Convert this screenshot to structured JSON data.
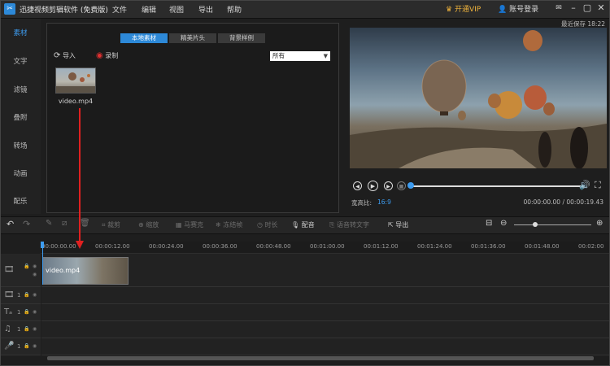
{
  "titlebar": {
    "app_title": "迅捷视频剪辑软件 (免费版)",
    "menus": [
      "文件",
      "编辑",
      "视图",
      "导出",
      "帮助"
    ],
    "vip": "开通VIP",
    "login": "账号登录",
    "icons": [
      "app-logo-icon",
      "vip-crown-icon",
      "user-icon",
      "feedback-icon",
      "minimize-icon",
      "maximize-icon",
      "close-icon"
    ]
  },
  "leftnav": {
    "items": [
      "素材",
      "文字",
      "滤镜",
      "叠附",
      "转场",
      "动画",
      "配乐"
    ],
    "active": "素材"
  },
  "media": {
    "tabs": [
      "本地素材",
      "精美片头",
      "背景样例"
    ],
    "active_tab": "本地素材",
    "import_label": "导入",
    "record_label": "录制",
    "filter_value": "所有",
    "files": [
      {
        "name": "video.mp4"
      }
    ]
  },
  "preview": {
    "autosave": "最近保存 18:22",
    "aspect_label": "宽高比:",
    "aspect_value": "16:9",
    "timecode": "00:00:00.00 / 00:00:19.43",
    "progress": 0
  },
  "toolbar": {
    "items": [
      "裁剪",
      "缩放",
      "马赛克",
      "冻结帧",
      "时长",
      "配音",
      "语音转文字",
      "导出"
    ],
    "enabled": [
      "配音",
      "导出"
    ]
  },
  "timeline": {
    "ticks": [
      "00:00:00.00",
      "00:00:12.00",
      "00:00:24.00",
      "00:00:36.00",
      "00:00:48.00",
      "00:01:00.00",
      "00:01:12.00",
      "00:01:24.00",
      "00:01:36.00",
      "00:01:48.00",
      "00:02:00"
    ],
    "tracks": [
      {
        "type": "video",
        "icon": "film-icon",
        "number": ""
      },
      {
        "type": "overlay",
        "icon": "film-icon",
        "number": "1"
      },
      {
        "type": "text",
        "icon": "text-icon",
        "number": "1"
      },
      {
        "type": "music",
        "icon": "music-icon",
        "number": "1"
      },
      {
        "type": "voice",
        "icon": "mic-icon",
        "number": "1"
      }
    ],
    "clip_label": "video.mp4"
  },
  "colors": {
    "accent": "#3d9cf0",
    "vip": "#f0b43c",
    "annotation": "#e02020"
  }
}
